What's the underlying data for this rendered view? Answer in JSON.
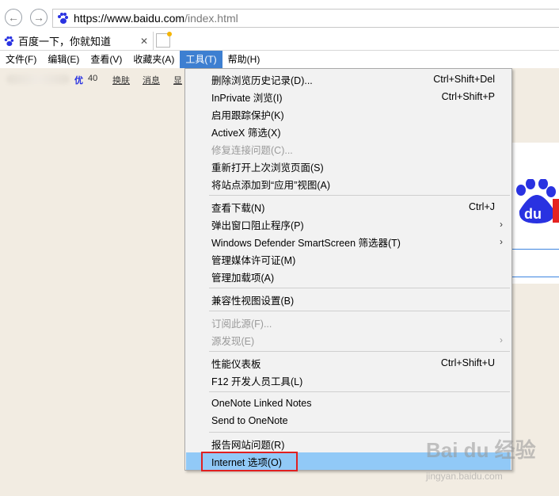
{
  "address_bar": {
    "url_host": "https://www.baidu.com",
    "url_path": "/index.html"
  },
  "tab": {
    "title": "百度一下，你就知道",
    "close": "✕"
  },
  "menubar": [
    {
      "label": "文件(F)"
    },
    {
      "label": "编辑(E)"
    },
    {
      "label": "查看(V)"
    },
    {
      "label": "收藏夹(A)"
    },
    {
      "label": "工具(T)",
      "active": true
    },
    {
      "label": "帮助(H)"
    }
  ],
  "page": {
    "top_nav": {
      "badge": "优",
      "count": "40",
      "link1": "换肤",
      "link2": "消息",
      "link3": "显"
    }
  },
  "tools_menu": {
    "items": [
      {
        "label": "删除浏览历史记录(D)...",
        "shortcut": "Ctrl+Shift+Del"
      },
      {
        "label": "InPrivate 浏览(I)",
        "shortcut": "Ctrl+Shift+P"
      },
      {
        "label": "启用跟踪保护(K)"
      },
      {
        "label": "ActiveX 筛选(X)"
      },
      {
        "label": "修复连接问题(C)...",
        "disabled": true
      },
      {
        "label": "重新打开上次浏览页面(S)"
      },
      {
        "label": "将站点添加到“应用”视图(A)"
      },
      {
        "label": "查看下载(N)",
        "shortcut": "Ctrl+J"
      },
      {
        "label": "弹出窗口阻止程序(P)",
        "submenu": "›"
      },
      {
        "label": "Windows Defender SmartScreen 筛选器(T)",
        "submenu": "›"
      },
      {
        "label": "管理媒体许可证(M)"
      },
      {
        "label": "管理加载项(A)"
      },
      {
        "label": "兼容性视图设置(B)"
      },
      {
        "label": "订阅此源(F)...",
        "disabled": true
      },
      {
        "label": "源发现(E)",
        "disabled": true,
        "submenu": "›"
      },
      {
        "label": "性能仪表板",
        "shortcut": "Ctrl+Shift+U"
      },
      {
        "label": "F12 开发人员工具(L)"
      },
      {
        "label": "OneNote Linked Notes"
      },
      {
        "label": "Send to OneNote"
      },
      {
        "label": "报告网站问题(R)"
      },
      {
        "label": "Internet 选项(O)",
        "highlighted": true
      }
    ]
  },
  "watermark": {
    "text": "Bai du 经验",
    "sub": "jingyan.baidu.com"
  },
  "colors": {
    "menu_active": "#3d7fd1",
    "highlight": "#91c9f7",
    "annotation_box": "#e02020",
    "baidu_blue": "#2932e1",
    "baidu_red": "#e52321"
  }
}
